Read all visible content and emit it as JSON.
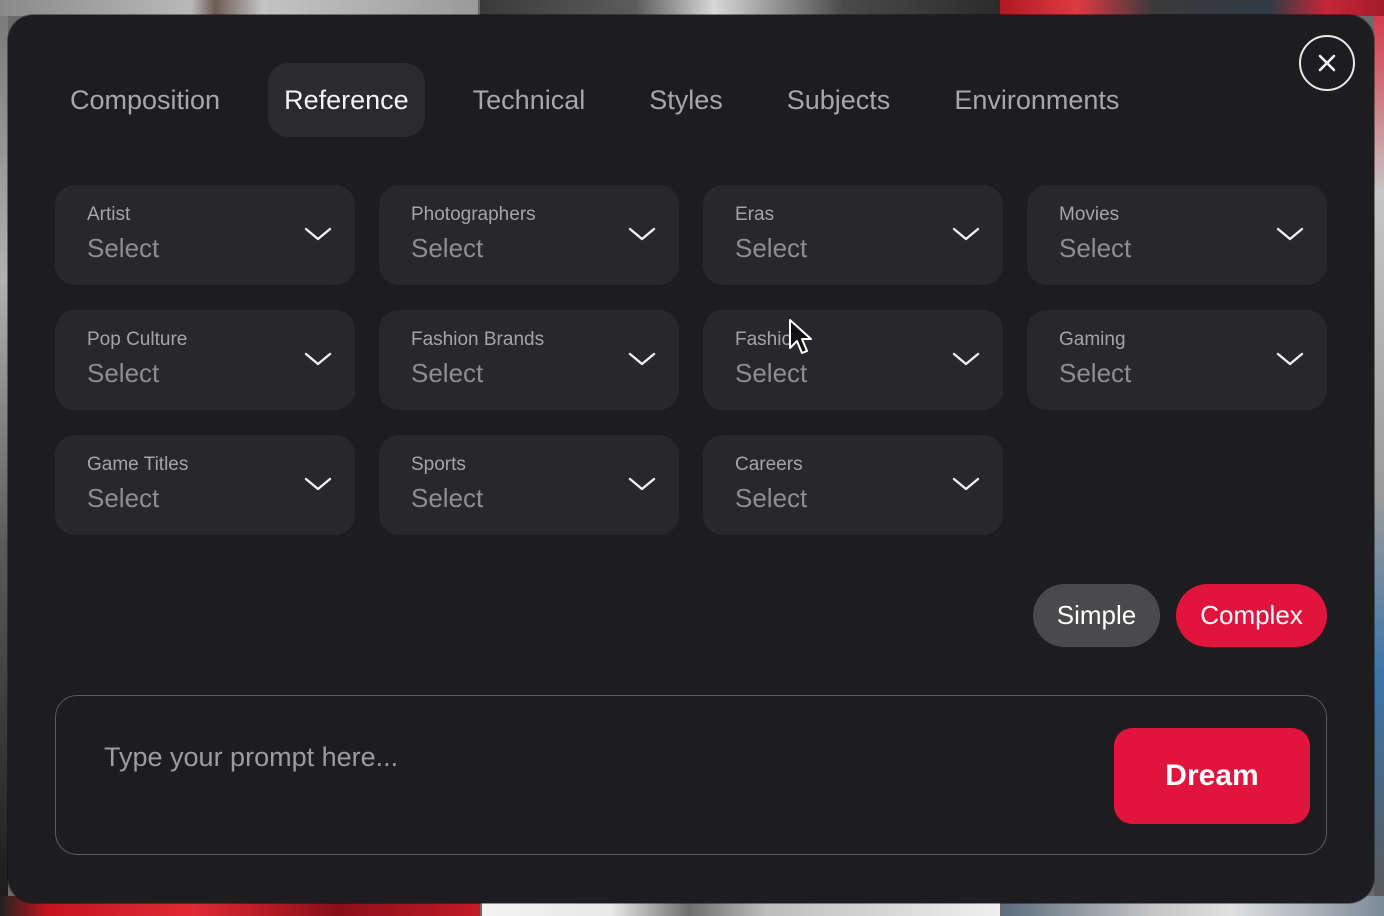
{
  "tabs": [
    {
      "label": "Composition",
      "active": false
    },
    {
      "label": "Reference",
      "active": true
    },
    {
      "label": "Technical",
      "active": false
    },
    {
      "label": "Styles",
      "active": false
    },
    {
      "label": "Subjects",
      "active": false
    },
    {
      "label": "Environments",
      "active": false
    }
  ],
  "dropdowns": [
    {
      "label": "Artist",
      "value": "Select"
    },
    {
      "label": "Photographers",
      "value": "Select"
    },
    {
      "label": "Eras",
      "value": "Select"
    },
    {
      "label": "Movies",
      "value": "Select"
    },
    {
      "label": "Pop Culture",
      "value": "Select"
    },
    {
      "label": "Fashion Brands",
      "value": "Select"
    },
    {
      "label": "Fashion",
      "value": "Select"
    },
    {
      "label": "Gaming",
      "value": "Select"
    },
    {
      "label": "Game Titles",
      "value": "Select"
    },
    {
      "label": "Sports",
      "value": "Select"
    },
    {
      "label": "Careers",
      "value": "Select"
    }
  ],
  "mode": {
    "simple_label": "Simple",
    "complex_label": "Complex",
    "selected": "Complex"
  },
  "prompt": {
    "value": "",
    "placeholder": "Type your prompt here...",
    "submit_label": "Dream"
  },
  "icons": {
    "close": "close-icon",
    "chevron": "chevron-down-icon",
    "cursor": "mouse-pointer-icon"
  },
  "colors": {
    "accent": "#e0143c",
    "panel": "#1d1c1f",
    "field": "#28272b"
  }
}
